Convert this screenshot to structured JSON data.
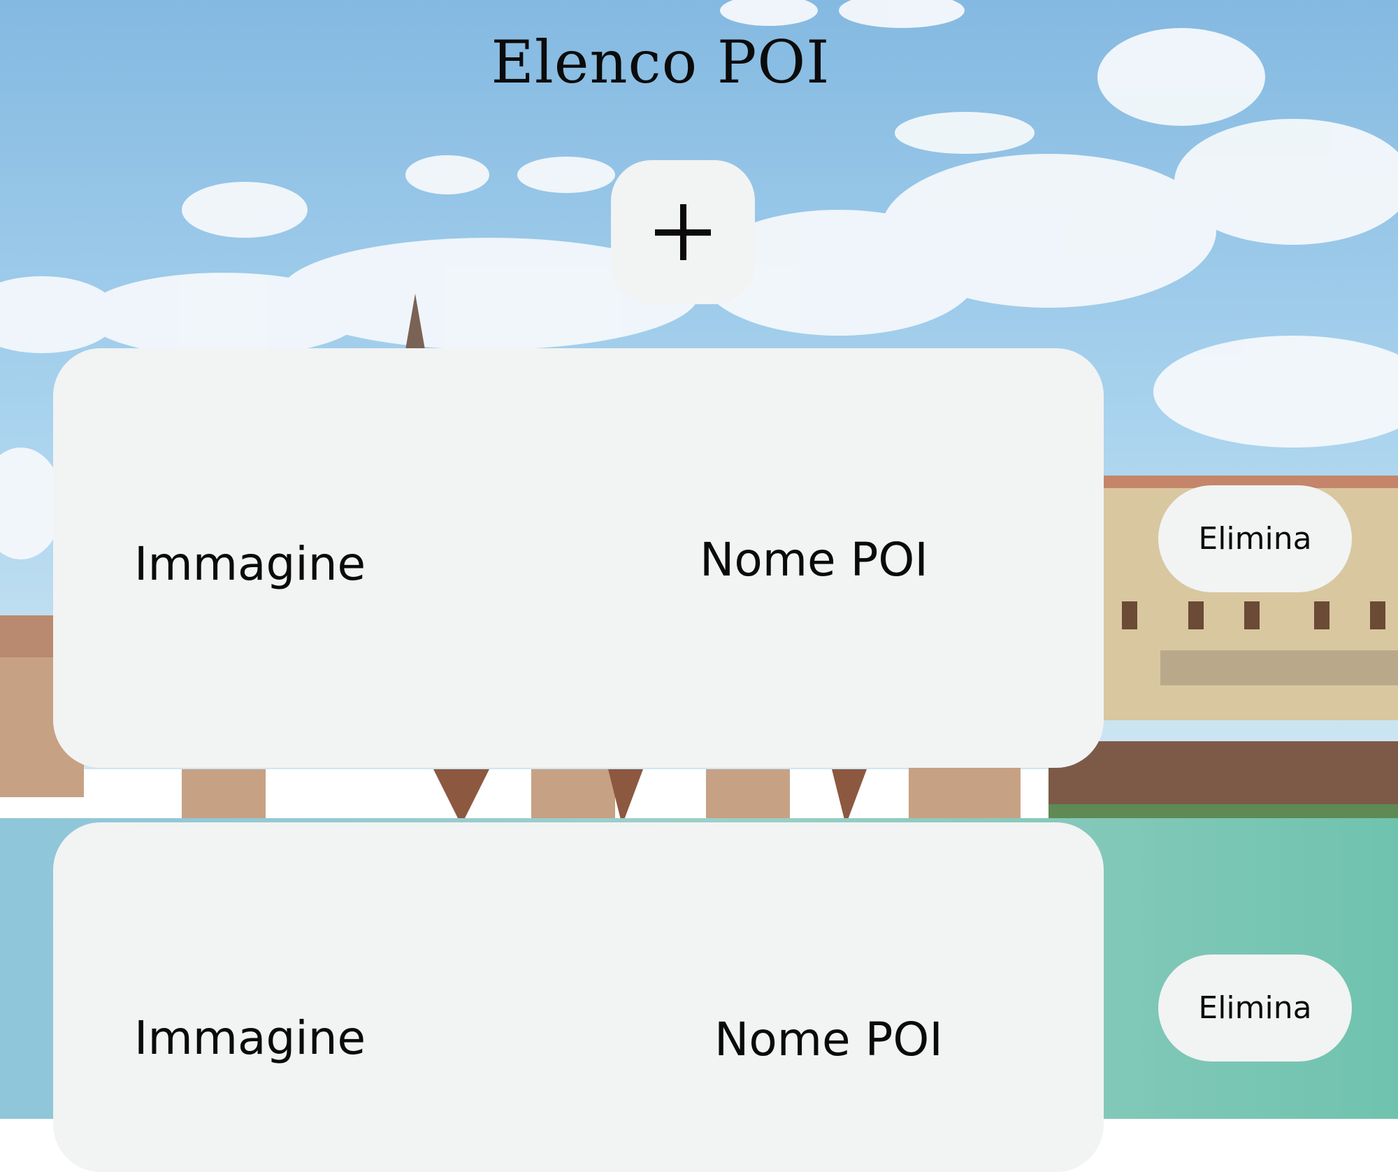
{
  "header": {
    "title": "Elenco POI"
  },
  "toolbar": {
    "add_icon": "plus-icon"
  },
  "poi_list": [
    {
      "image_label": "Immagine",
      "name_label": "Nome POI",
      "delete_label": "Elimina"
    },
    {
      "image_label": "Immagine",
      "name_label": "Nome POI",
      "delete_label": "Elimina"
    }
  ],
  "theme": {
    "card_background": "#f2f3f3",
    "text_color": "#0a0a0a",
    "sky_color": "#86bde3",
    "water_color": "#7fc4b8"
  }
}
